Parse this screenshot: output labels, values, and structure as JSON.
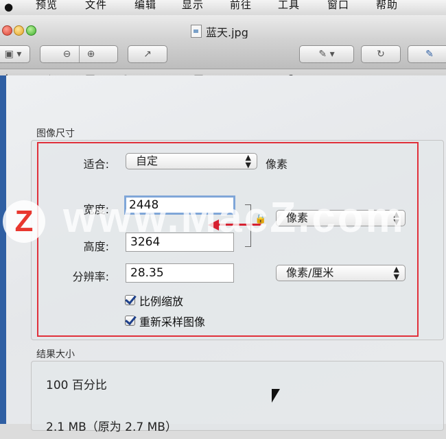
{
  "menubar": {
    "apple": "",
    "items": [
      "预览",
      "文件",
      "编辑",
      "显示",
      "前往",
      "工具",
      "窗口",
      "帮助"
    ]
  },
  "window": {
    "title": "蓝天.jpg"
  },
  "toolbar": {
    "zoom_out_icon": "zoom-out-icon",
    "zoom_in_icon": "zoom-in-icon",
    "share_icon": "share-icon"
  },
  "edit_tools": [
    "selection-icon",
    "magic-wand-icon",
    "rectangle-icon",
    "ellipse-icon",
    "line-icon",
    "crop-icon",
    "adjust-color-icon",
    "resize-icon"
  ],
  "image_size": {
    "section_title": "图像尺寸",
    "fit_label": "适合:",
    "fit_value": "自定",
    "fit_unit": "像素",
    "width_label": "宽度:",
    "width_value": "2448",
    "height_label": "高度:",
    "height_value": "3264",
    "unit_value": "像素",
    "resolution_label": "分辨率:",
    "resolution_value": "28.35",
    "resolution_unit": "像素/厘米",
    "scale_label": "比例缩放",
    "resample_label": "重新采样图像"
  },
  "result": {
    "section_title": "结果大小",
    "percent": "100 百分比",
    "size": "2.1 MB（原为 2.7 MB）"
  },
  "watermark": {
    "badge": "Z",
    "text": "www.MacZ.com"
  },
  "colors": {
    "highlight_box": "#e0303a",
    "arrow": "#d62030",
    "focus_ring": "#7fa6d8"
  }
}
